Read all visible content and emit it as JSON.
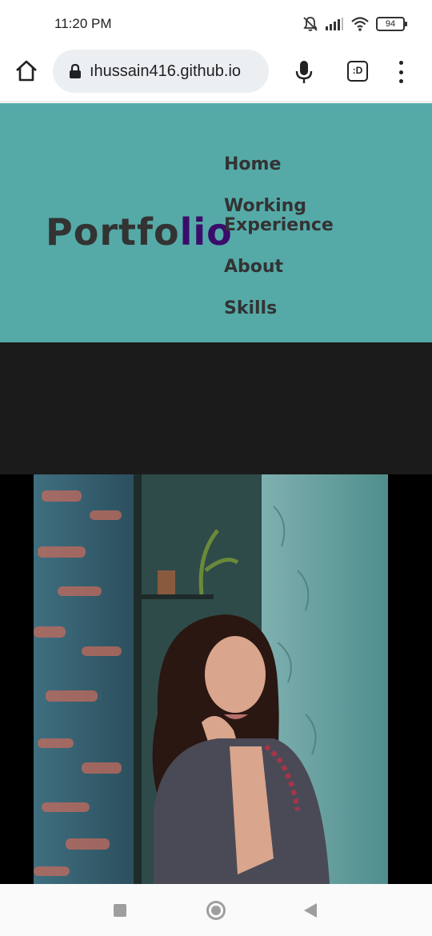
{
  "status_bar": {
    "time": "11:20 PM",
    "battery": "94"
  },
  "browser": {
    "url": "ıhussain416.github.io",
    "tabs_label": ":D"
  },
  "site": {
    "logo_main": "Portfo",
    "logo_accent": "lio",
    "nav": {
      "home": "Home",
      "working_experience": "Working Experience",
      "about": "About",
      "skills": "Skills"
    }
  },
  "colors": {
    "header_bg": "#55aaa8",
    "logo_text": "#333333",
    "logo_accent": "#3b0d6a",
    "dark_band": "#1b1b1b"
  },
  "icons": {
    "status": [
      "mute-bell-icon",
      "signal-icon",
      "wifi-icon",
      "battery-icon"
    ],
    "toolbar": [
      "home-icon",
      "lock-icon",
      "mic-icon",
      "tabs-icon",
      "more-vert-icon"
    ],
    "android_nav": [
      "recents-icon",
      "home-circle-icon",
      "back-icon"
    ]
  }
}
